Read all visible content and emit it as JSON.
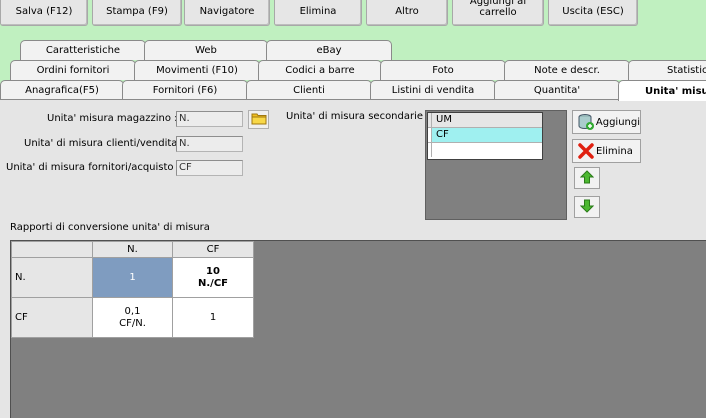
{
  "toolbar": {
    "buttons": [
      {
        "label": "Salva (F12)"
      },
      {
        "label": "Stampa (F9)"
      },
      {
        "label": "Navigatore"
      },
      {
        "label": "Elimina"
      },
      {
        "label": "Altro"
      },
      {
        "label": "Aggiungi al carrello"
      },
      {
        "label": "Uscita (ESC)"
      }
    ]
  },
  "tabs": {
    "row1": [
      {
        "label": "Caratteristiche"
      },
      {
        "label": "Web"
      },
      {
        "label": "eBay"
      }
    ],
    "row2": [
      {
        "label": "Ordini fornitori"
      },
      {
        "label": "Movimenti (F10)"
      },
      {
        "label": "Codici a barre"
      },
      {
        "label": "Foto"
      },
      {
        "label": "Note e descr."
      },
      {
        "label": "Statistich"
      }
    ],
    "row3": [
      {
        "label": "Anagrafica(F5)"
      },
      {
        "label": "Fornitori (F6)"
      },
      {
        "label": "Clienti"
      },
      {
        "label": "Listini di vendita"
      },
      {
        "label": "Quantita'"
      },
      {
        "label": "Unita' misu"
      }
    ]
  },
  "form": {
    "magazzino_label": "Unita' misura magazzino :",
    "magazzino_value": "N.",
    "clienti_label": "Unita' di misura clienti/vendita :",
    "clienti_value": "N.",
    "fornitori_label": "Unita' di misura fornitori/acquisto :",
    "fornitori_value": "CF",
    "secondarie_label": "Unita' di misura secondarie :"
  },
  "um_list": {
    "header": "UM",
    "rows": [
      "CF",
      ""
    ]
  },
  "side_buttons": {
    "add": "Aggiungi",
    "delete": "Elimina"
  },
  "conversion": {
    "title": "Rapporti di conversione unita' di misura",
    "cols": [
      "N.",
      "CF"
    ],
    "rows": [
      {
        "label": "N.",
        "cells": [
          "1",
          "10\nN./CF"
        ]
      },
      {
        "label": "CF",
        "cells": [
          "0,1\nCF/N.",
          "1"
        ]
      }
    ]
  },
  "colors": {
    "background": "#c0f0c0",
    "selected_row": "#9ff0f0",
    "diagonal_selected": "#7f9cc0"
  }
}
